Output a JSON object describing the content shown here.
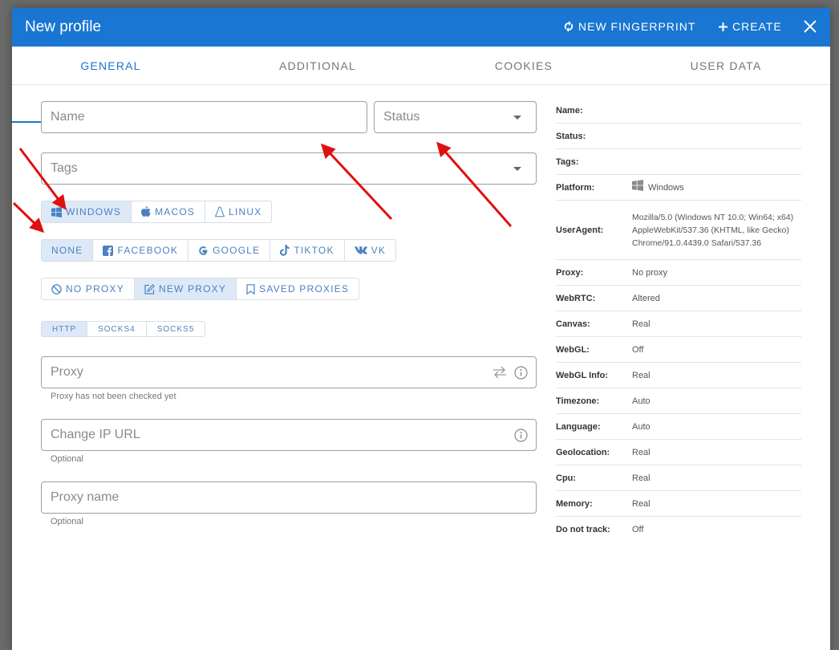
{
  "header": {
    "title": "New profile",
    "new_fingerprint_label": "NEW FINGERPRINT",
    "create_label": "CREATE"
  },
  "tabs": [
    {
      "label": "GENERAL",
      "active": true
    },
    {
      "label": "ADDITIONAL",
      "active": false
    },
    {
      "label": "COOKIES",
      "active": false
    },
    {
      "label": "USER DATA",
      "active": false
    }
  ],
  "form": {
    "name_placeholder": "Name",
    "status_placeholder": "Status",
    "tags_placeholder": "Tags",
    "os_buttons": [
      {
        "label": "WINDOWS",
        "icon": "windows-icon",
        "selected": true
      },
      {
        "label": "MACOS",
        "icon": "apple-icon",
        "selected": false
      },
      {
        "label": "LINUX",
        "icon": "linux-icon",
        "selected": false
      }
    ],
    "site_buttons": [
      {
        "label": "NONE",
        "selected": true
      },
      {
        "label": "FACEBOOK",
        "icon": "facebook-icon"
      },
      {
        "label": "GOOGLE",
        "icon": "google-icon"
      },
      {
        "label": "TIKTOK",
        "icon": "tiktok-icon"
      },
      {
        "label": "VK",
        "icon": "vk-icon"
      }
    ],
    "proxy_mode_buttons": [
      {
        "label": "NO PROXY",
        "icon": "block-icon"
      },
      {
        "label": "NEW PROXY",
        "icon": "edit-icon",
        "selected": true
      },
      {
        "label": "SAVED PROXIES",
        "icon": "bookmark-icon"
      }
    ],
    "protocol_buttons": [
      {
        "label": "HTTP",
        "selected": true
      },
      {
        "label": "SOCKS4"
      },
      {
        "label": "SOCKS5"
      }
    ],
    "proxy_placeholder": "Proxy",
    "proxy_hint": "Proxy has not been checked yet",
    "change_ip_placeholder": "Change IP URL",
    "change_ip_hint": "Optional",
    "proxy_name_placeholder": "Proxy name",
    "proxy_name_hint": "Optional"
  },
  "summary": {
    "name": {
      "key": "Name:",
      "value": ""
    },
    "status": {
      "key": "Status:",
      "value": ""
    },
    "tags": {
      "key": "Tags:",
      "value": ""
    },
    "platform": {
      "key": "Platform:",
      "value": "Windows"
    },
    "useragent": {
      "key": "UserAgent:",
      "value": "Mozilla/5.0 (Windows NT 10.0; Win64; x64) AppleWebKit/537.36 (KHTML, like Gecko) Chrome/91.0.4439.0 Safari/537.36"
    },
    "proxy": {
      "key": "Proxy:",
      "value": "No proxy"
    },
    "webrtc": {
      "key": "WebRTC:",
      "value": "Altered"
    },
    "canvas": {
      "key": "Canvas:",
      "value": "Real"
    },
    "webgl": {
      "key": "WebGL:",
      "value": "Off"
    },
    "webgl_info": {
      "key": "WebGL Info:",
      "value": "Real"
    },
    "timezone": {
      "key": "Timezone:",
      "value": "Auto"
    },
    "language": {
      "key": "Language:",
      "value": "Auto"
    },
    "geolocation": {
      "key": "Geolocation:",
      "value": "Real"
    },
    "cpu": {
      "key": "Cpu:",
      "value": "Real"
    },
    "memory": {
      "key": "Memory:",
      "value": "Real"
    },
    "dnt": {
      "key": "Do not track:",
      "value": "Off"
    }
  },
  "colors": {
    "header_bg": "#1976d2",
    "accent": "#1976d2",
    "button_text": "#4a82c0",
    "selected_bg": "#dde9f7",
    "annotation_arrow": "#e01010"
  }
}
